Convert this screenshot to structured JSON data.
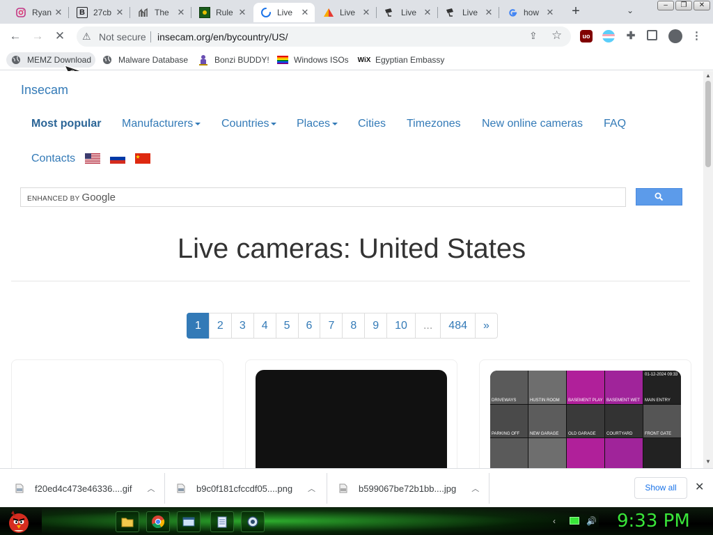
{
  "tabs": [
    {
      "title": "Ryan",
      "icon": "instagram-icon"
    },
    {
      "title": "27cb",
      "icon": "b-letter-icon"
    },
    {
      "title": "The",
      "icon": "chart-bars-icon"
    },
    {
      "title": "Rule",
      "icon": "green-square-icon"
    },
    {
      "title": "Live",
      "icon": "loading-spinner-icon"
    },
    {
      "title": "Live",
      "icon": "warning-triangle-icon"
    },
    {
      "title": "Live",
      "icon": "camera-icon"
    },
    {
      "title": "Live",
      "icon": "camera-icon"
    },
    {
      "title": "how",
      "icon": "google-g-icon"
    }
  ],
  "window": {
    "minimize": "‒",
    "restore": "❐",
    "close": "✕"
  },
  "omnibox": {
    "security": "Not secure",
    "url": "insecam.org/en/bycountry/US/"
  },
  "bookmarks": [
    "MEMZ Download",
    "Malware Database",
    "Bonzi BUDDY!",
    "Windows ISOs",
    "Egyptian Embassy"
  ],
  "site": {
    "brand": "Insecam",
    "nav": {
      "most_popular": "Most popular",
      "manufacturers": "Manufacturers",
      "countries": "Countries",
      "places": "Places",
      "cities": "Cities",
      "timezones": "Timezones",
      "new_online": "New online cameras",
      "faq": "FAQ",
      "contacts": "Contacts"
    },
    "search": {
      "enhanced_by": "ENHANCED BY",
      "provider": "Google"
    },
    "heading": "Live cameras: United States",
    "pagination": [
      "1",
      "2",
      "3",
      "4",
      "5",
      "6",
      "7",
      "8",
      "9",
      "10",
      "...",
      "484",
      "»"
    ],
    "active_page": "1",
    "camera_labels": [
      "DRIVEWAYS",
      "HUSTIN ROOM",
      "BASEMENT PLAY",
      "BASEMENT WET",
      "MAIN ENTRY",
      "PARKING OFF",
      "NEW GARAGE",
      "OLD GARAGE",
      "COURTYARD",
      "FRONT GATE"
    ],
    "camera_timestamp": "01-12-2024 09:33"
  },
  "downloads": [
    {
      "name": "f20ed4c473e46336....gif"
    },
    {
      "name": "b9c0f181cfccdf05....png"
    },
    {
      "name": "b599067be72b1bb....jpg"
    }
  ],
  "download_bar": {
    "show_all": "Show all"
  },
  "taskbar": {
    "clock": "9:33 PM"
  },
  "colors": {
    "link": "#337ab7",
    "active_page": "#337ab7",
    "search_button": "#5c9bea",
    "clock": "#39e639"
  }
}
